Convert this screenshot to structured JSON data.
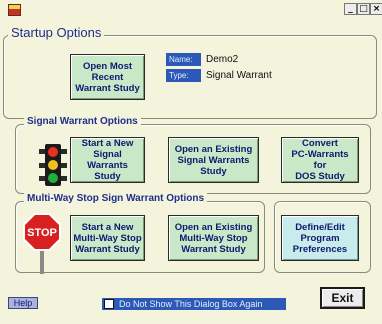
{
  "window": {
    "min_label": "_",
    "max_label": "□",
    "close_label": "×"
  },
  "startup": {
    "title": "Startup Options",
    "open_recent_label": "Open Most\nRecent\nWarrant Study",
    "name_label": "Name:",
    "name_value": "Demo2",
    "type_label": "Type:",
    "type_value": "Signal Warrant"
  },
  "signal": {
    "title": "Signal Warrant Options",
    "start_new_label": "Start a New\nSignal\nWarrants Study",
    "open_existing_label": "Open an Existing\nSignal Warrants\nStudy",
    "convert_label": "Convert\nPC-Warrants for\nDOS Study"
  },
  "multiway": {
    "title": "Multi-Way Stop Sign Warrant Options",
    "start_new_label": "Start a New\nMulti-Way Stop\nWarrant Study",
    "open_existing_label": "Open an Existing\nMulti-Way Stop\nWarrant Study",
    "stop_text": "STOP"
  },
  "prefs": {
    "label": "Define/Edit\nProgram\nPreferences"
  },
  "footer": {
    "help_label": "Help",
    "dont_show_label": "Do Not Show This Dialog Box Again",
    "exit_label": "Exit"
  },
  "icons": [
    "app-icon",
    "traffic-light-icon",
    "stop-sign-icon"
  ]
}
